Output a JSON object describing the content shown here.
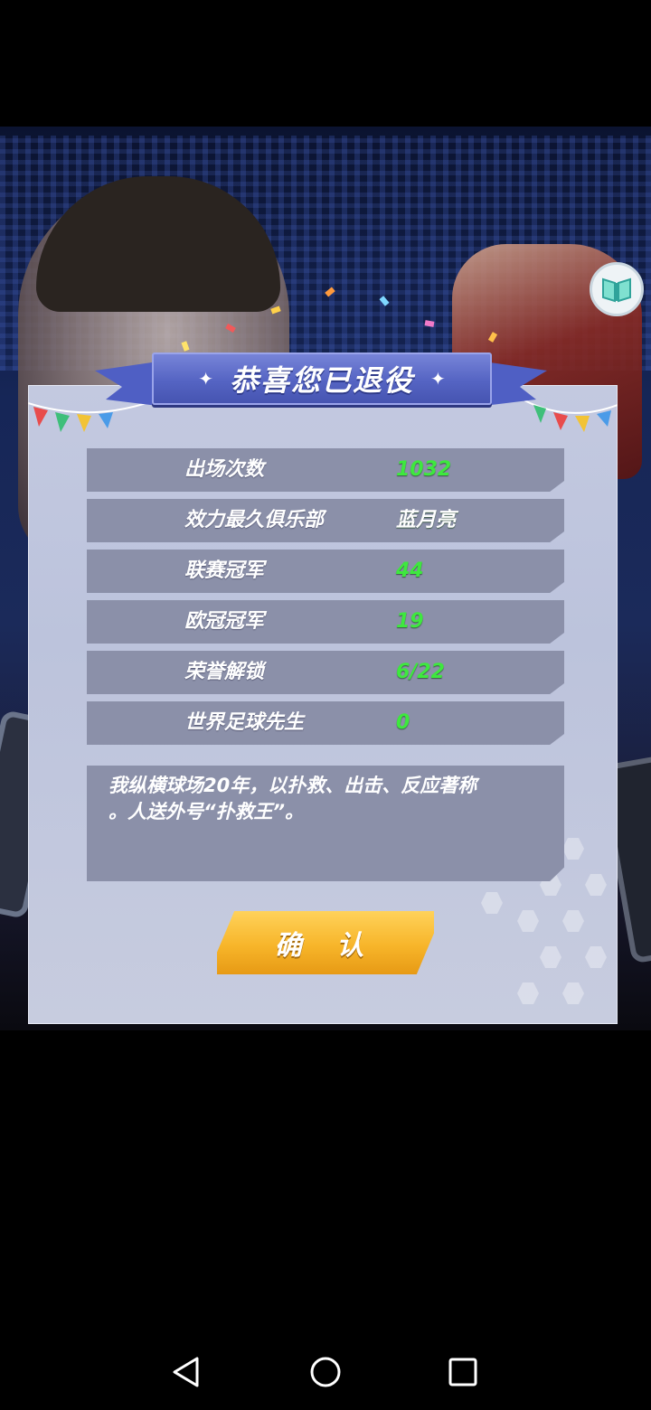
{
  "dialog": {
    "title": "恭喜您已退役",
    "stats": [
      {
        "label": "出场次数",
        "value": "1032",
        "value_color": "#3ee83e"
      },
      {
        "label": "效力最久俱乐部",
        "value": "蓝月亮",
        "value_color": "#ffffff"
      },
      {
        "label": "联赛冠军",
        "value": "44",
        "value_color": "#3ee83e"
      },
      {
        "label": "欧冠冠军",
        "value": "19",
        "value_color": "#3ee83e"
      },
      {
        "label": "荣誉解锁",
        "value": "6/22",
        "value_color": "#3ee83e"
      },
      {
        "label": "世界足球先生",
        "value": "0",
        "value_color": "#3ee83e"
      }
    ],
    "bio_line1": "我纵横球场20年，以扑救、出击、反应著称",
    "bio_line2": "。人送外号“扑救王”。",
    "confirm_label": "确 认"
  },
  "side_button": {
    "icon": "book-icon"
  },
  "nav": {
    "back": "back-triangle-icon",
    "home": "home-circle-icon",
    "recents": "recents-square-icon"
  },
  "colors": {
    "accent_green": "#3ee83e",
    "banner_blue": "#5564c3",
    "button_orange": "#f7b52a",
    "row_bg": "#8b90a9"
  }
}
